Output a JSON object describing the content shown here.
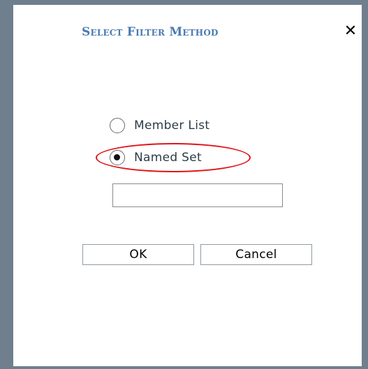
{
  "dialog": {
    "title": "Select Filter Method",
    "close_glyph": "✕",
    "close_icon": "close-icon"
  },
  "options": [
    {
      "label": "Member List",
      "checked": false
    },
    {
      "label": "Named Set",
      "checked": true
    }
  ],
  "named_set_input": {
    "value": "",
    "placeholder": ""
  },
  "buttons": {
    "ok_label": "OK",
    "cancel_label": "Cancel"
  },
  "colors": {
    "title": "#4a7ab0",
    "frame": "#6f7f8d",
    "highlight_ring": "#e0141a"
  }
}
